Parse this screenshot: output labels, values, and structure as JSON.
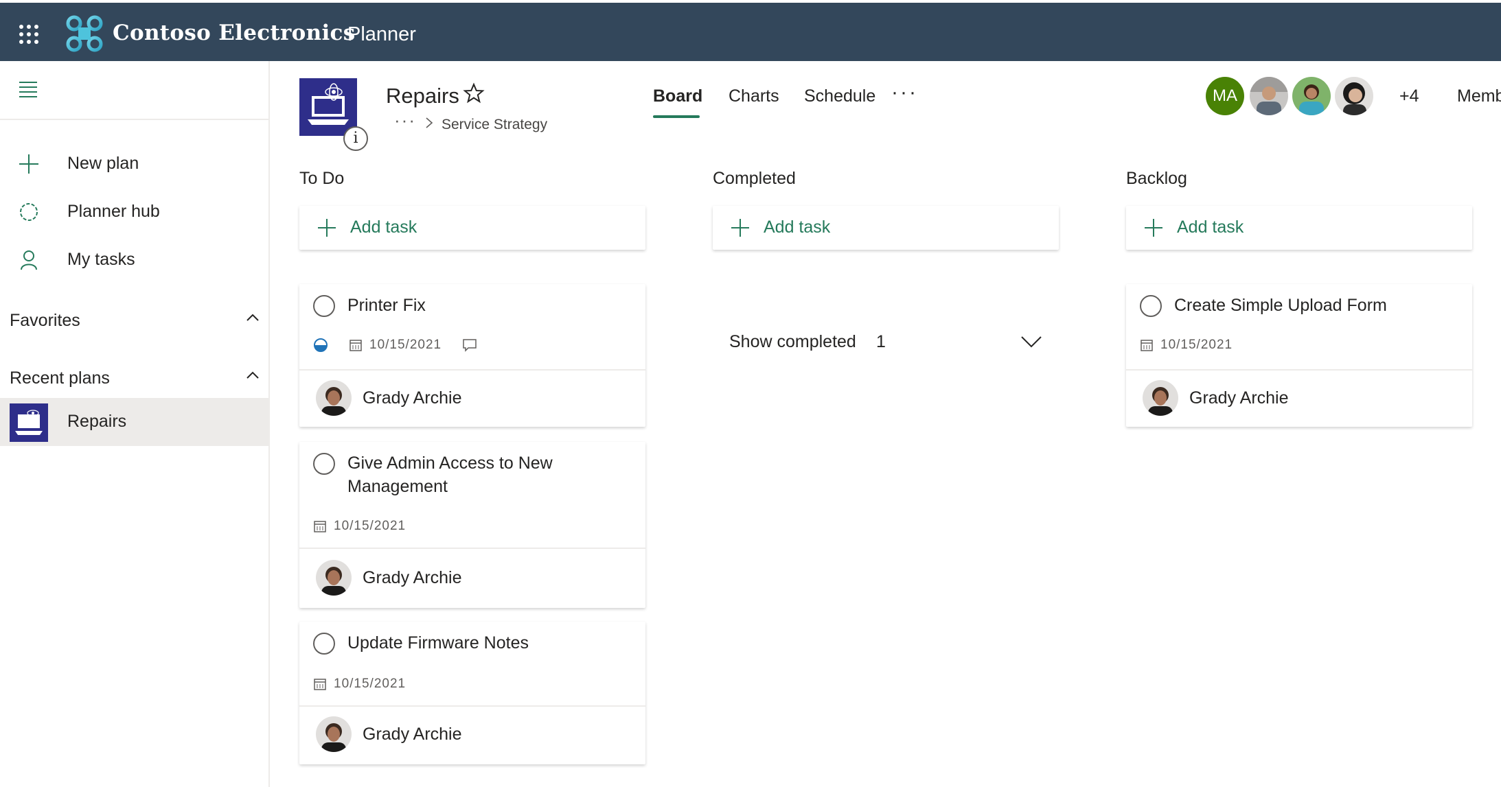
{
  "topbar": {
    "brand": "Contoso Electronics",
    "app": "Planner"
  },
  "nav": {
    "items": [
      {
        "label": "New plan",
        "icon": "plus-icon"
      },
      {
        "label": "Planner hub",
        "icon": "circle-icon"
      },
      {
        "label": "My tasks",
        "icon": "person-icon"
      }
    ],
    "favorites": "Favorites",
    "recent": "Recent plans",
    "recent_plans": [
      {
        "label": "Repairs"
      }
    ]
  },
  "plan": {
    "title": "Repairs",
    "info": "i",
    "breadcrumb_dots": "···",
    "breadcrumb": "Service Strategy"
  },
  "tabs": {
    "board": "Board",
    "charts": "Charts",
    "schedule": "Schedule",
    "more": "···"
  },
  "members": {
    "initials": "MA",
    "more": "+4",
    "link": "Memb"
  },
  "buckets": [
    {
      "title": "To Do",
      "add": "Add task"
    },
    {
      "title": "Completed",
      "add": "Add task",
      "show_completed": "Show completed",
      "completed_count": "1"
    },
    {
      "title": "Backlog",
      "add": "Add task"
    }
  ],
  "tasks": {
    "todo": [
      {
        "title": "Printer Fix",
        "date": "10/15/2021",
        "assignee": "Grady Archie",
        "progress": 0.5
      },
      {
        "title": "Give Admin Access to New Management",
        "date": "10/15/2021",
        "assignee": "Grady Archie"
      },
      {
        "title": "Update Firmware Notes",
        "date": "10/15/2021",
        "assignee": "Grady Archie"
      }
    ],
    "backlog": [
      {
        "title": "Create Simple Upload Form",
        "date": "10/15/2021",
        "assignee": "Grady Archie"
      }
    ]
  },
  "colors": {
    "topbar": "#33475b",
    "accent": "#257a5b",
    "plan_thumb": "#2e2e8a",
    "member_ma": "#498205"
  }
}
